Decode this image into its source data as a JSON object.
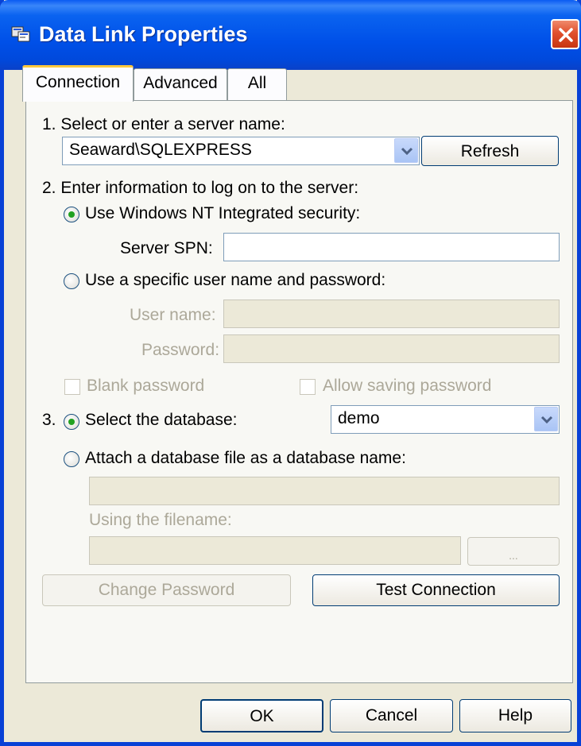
{
  "window": {
    "title": "Data Link Properties"
  },
  "tabs": [
    "Connection",
    "Advanced",
    "All"
  ],
  "connection": {
    "step1_label": "1. Select or enter a server name:",
    "server_value": "Seaward\\SQLEXPRESS",
    "refresh_label": "Refresh",
    "step2_label": "2. Enter information to log on to the server:",
    "nt_security_label": "Use Windows NT Integrated security:",
    "spn_label": "Server SPN:",
    "spn_value": "",
    "specific_user_label": "Use a specific user name and password:",
    "username_label": "User name:",
    "password_label": "Password:",
    "blank_password_label": "Blank password",
    "allow_saving_label": "Allow saving password",
    "step3_prefix": "3.",
    "select_db_label": "Select the database:",
    "database_value": "demo",
    "attach_db_label": "Attach a database file as a database name:",
    "filename_label": "Using the filename:",
    "browse_label": "...",
    "change_password_label": "Change Password",
    "test_connection_label": "Test Connection"
  },
  "footer": {
    "ok_label": "OK",
    "cancel_label": "Cancel",
    "help_label": "Help"
  },
  "colors": {
    "title_bar": "#0050e8",
    "dialog_face": "#ece9d8",
    "radio_selected": "#21a121",
    "tab_highlight": "#ffc83c"
  }
}
